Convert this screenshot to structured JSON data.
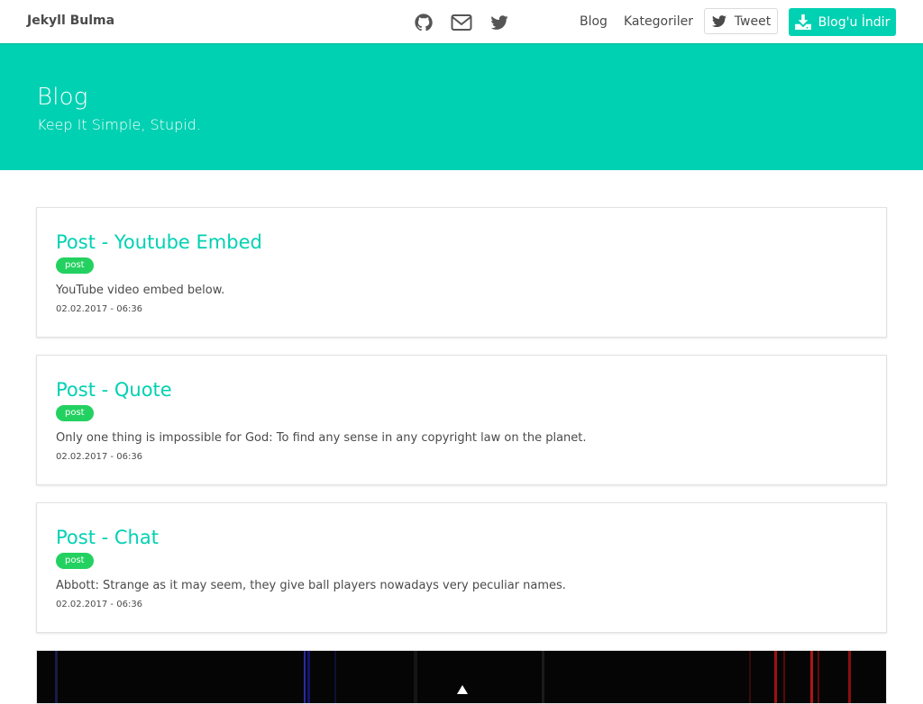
{
  "navbar": {
    "brand": "Jekyll Bulma",
    "icons": [
      "github-icon",
      "envelope-icon",
      "twitter-icon"
    ],
    "links": [
      "Blog",
      "Kategoriler"
    ],
    "tweet_label": "Tweet",
    "download_label": "Blog'u İndir"
  },
  "hero": {
    "title": "Blog",
    "subtitle": "Keep It Simple, Stupid."
  },
  "posts": [
    {
      "title": "Post - Youtube Embed",
      "tag": "post",
      "excerpt": "YouTube video embed below.",
      "date": "02.02.2017 - 06:36"
    },
    {
      "title": "Post - Quote",
      "tag": "post",
      "excerpt": "Only one thing is impossible for God: To find any sense in any copyright law on the planet.",
      "date": "02.02.2017 - 06:36"
    },
    {
      "title": "Post - Chat",
      "tag": "post",
      "excerpt": "Abbott: Strange as it may seem, they give ball players nowadays very peculiar names.",
      "date": "02.02.2017 - 06:36"
    }
  ],
  "colors": {
    "primary": "#00d1b2",
    "tag": "#23d160",
    "text": "#4a4a4a"
  }
}
